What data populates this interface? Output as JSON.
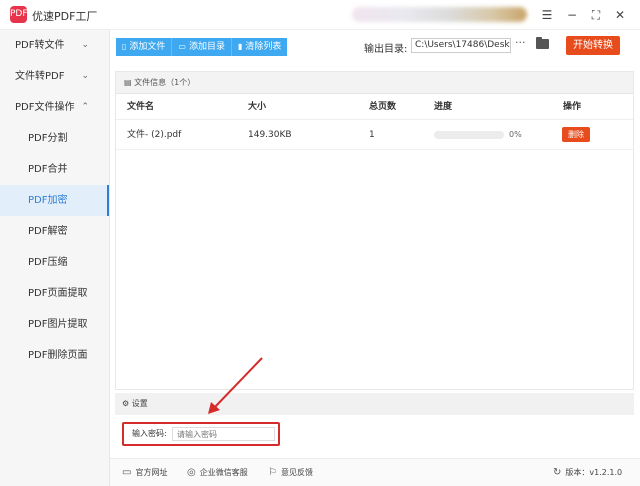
{
  "app": {
    "title": "优速PDF工厂",
    "logo_text": "PDF",
    "version": "版本：v1.2.1.0",
    "accent_color": "#e84b1c",
    "brand_color": "#e8344a",
    "blue_color": "#3ea8f0"
  },
  "window_controls": {
    "menu": "☰",
    "minimize": "−",
    "maximize": "⛶",
    "close": "✕"
  },
  "sidebar": {
    "items": [
      {
        "label": "PDF转文件",
        "chevron": "⌄"
      },
      {
        "label": "文件转PDF",
        "chevron": "⌄"
      },
      {
        "label": "PDF文件操作",
        "chevron": "⌃"
      }
    ],
    "subitems": [
      {
        "label": "PDF分割"
      },
      {
        "label": "PDF合并"
      },
      {
        "label": "PDF加密",
        "active": true
      },
      {
        "label": "PDF解密"
      },
      {
        "label": "PDF压缩"
      },
      {
        "label": "PDF页面提取"
      },
      {
        "label": "PDF图片提取"
      },
      {
        "label": "PDF删除页面"
      }
    ]
  },
  "toolbar": {
    "add_file": "添加文件",
    "add_folder": "添加目录",
    "clear_list": "清除列表",
    "output_label": "输出目录:",
    "output_path": "C:\\Users\\17486\\Deskto",
    "more": "···",
    "convert": "开始转换"
  },
  "file_info": {
    "label": "文件信息（1个）"
  },
  "table": {
    "headers": [
      "文件名",
      "大小",
      "总页数",
      "进度",
      "操作"
    ],
    "rows": [
      {
        "name": "文件- (2).pdf",
        "size": "149.30KB",
        "pages": "1",
        "progress": 0,
        "progress_text": "0%",
        "action": "删除"
      }
    ]
  },
  "settings": {
    "title": "设置",
    "password_label": "输入密码:",
    "password_placeholder": "请输入密码",
    "password_value": ""
  },
  "footer": {
    "website": "官方网址",
    "wechat": "企业微信客服",
    "feedback": "意见反馈"
  }
}
